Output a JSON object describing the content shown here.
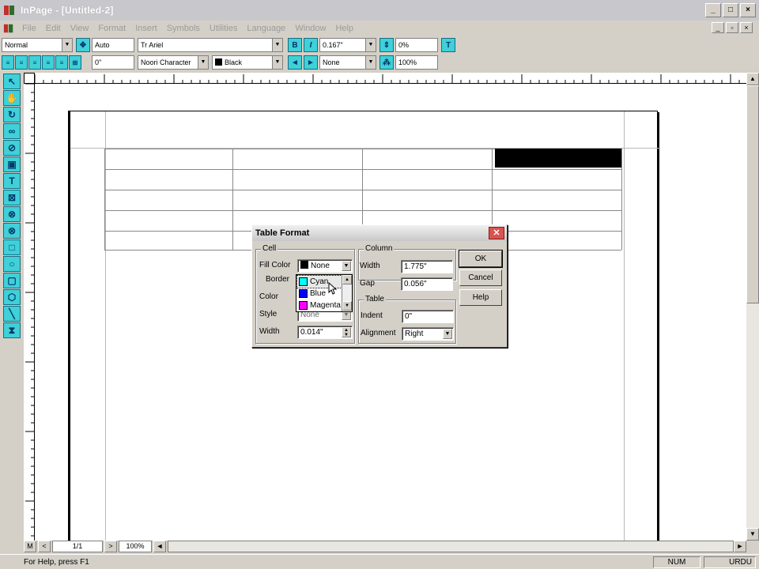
{
  "window": {
    "title": "InPage - [Untitled-2]",
    "minimize": "_",
    "maximize": "□",
    "close": "×",
    "doc_minimize": "_",
    "doc_restore": "▫",
    "doc_close": "×"
  },
  "menu": [
    "File",
    "Edit",
    "View",
    "Format",
    "Insert",
    "Symbols",
    "Utilities",
    "Language",
    "Window",
    "Help"
  ],
  "toolbar1": {
    "style": "Normal",
    "leading": "Auto",
    "font": "Ariel",
    "font_prefix": "Tr",
    "bold": "B",
    "italic": "I",
    "size": "0.167\"",
    "tracking": "0%"
  },
  "toolbar2": {
    "indent": "0\"",
    "char_type": "Noori Character",
    "color": "Black",
    "color_hex": "#000000",
    "stroke": "None",
    "scale": "100%"
  },
  "dialog": {
    "title": "Table Format",
    "cell_group": "Cell",
    "fill_color_label": "Fill Color",
    "fill_color_value": "None",
    "border_group": "Border",
    "color_label": "Color",
    "style_label": "Style",
    "style_value": "None",
    "width_label": "Width",
    "width_value": "0.014\"",
    "column_group": "Column",
    "col_width_label": "Width",
    "col_width_value": "1.775\"",
    "gap_label": "Gap",
    "gap_value": "0.056\"",
    "table_group": "Table",
    "indent_label": "Indent",
    "indent_value": "0\"",
    "alignment_label": "Alignment",
    "alignment_value": "Right",
    "ok": "OK",
    "cancel": "Cancel",
    "help": "Help",
    "color_options": [
      {
        "name": "Cyan",
        "hex": "#00ffff"
      },
      {
        "name": "Blue",
        "hex": "#0000ff"
      },
      {
        "name": "Magenta",
        "hex": "#ff00ff"
      }
    ],
    "colors": {
      "none_swatch": "#000000"
    }
  },
  "bottom": {
    "master": "M",
    "prev": "<",
    "page": "1/1",
    "next": ">",
    "zoom": "100%",
    "scroll_left": "◄"
  },
  "status": {
    "help_text": "For Help, press F1",
    "num": "NUM",
    "lang": "URDU"
  }
}
